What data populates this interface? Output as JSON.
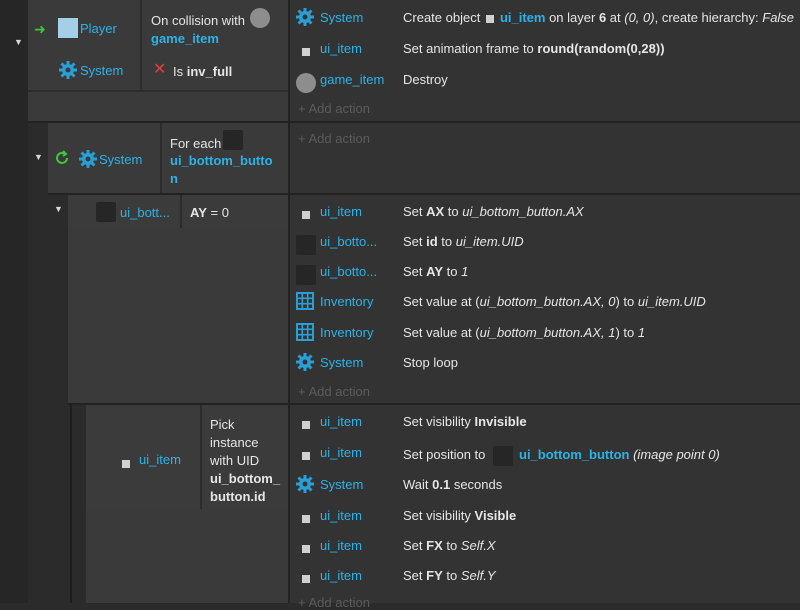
{
  "colors": {
    "object": "#2ab3e8",
    "background": "#2f2f2f",
    "green": "#3ec43e",
    "red": "#e04040"
  },
  "event1": {
    "trigger_icon": "green-arrow-icon",
    "player_label": "Player",
    "collision_label": "On collision with",
    "collision_object": "game_item",
    "system_label": "System",
    "is_label": "Is",
    "inv_full": "inv_full",
    "actions": [
      {
        "object": "System",
        "icon": "gear-icon",
        "parts": [
          "Create object ",
          "ui_item",
          " on layer ",
          "6",
          " at ",
          "(0, 0)",
          ", create hierarchy: ",
          "False"
        ]
      },
      {
        "object": "ui_item",
        "icon": "square-icon",
        "parts": [
          "Set animation frame to ",
          "round(random(0,28))"
        ]
      },
      {
        "object": "game_item",
        "icon": "circle-icon",
        "parts": [
          "Destroy"
        ]
      }
    ],
    "add_action": "+ Add action"
  },
  "event2": {
    "loop_icon": "loop-icon",
    "system_label": "System",
    "foreach_label": "For each",
    "foreach_object_line1": "ui_bottom_butto",
    "foreach_object_line2": "n",
    "add_action": "+ Add action"
  },
  "event3": {
    "object_label": "ui_bott...",
    "ay_label": "AY",
    "ay_op": "= 0",
    "actions": [
      {
        "object": "ui_item",
        "icon": "square-icon",
        "parts": [
          "Set ",
          "AX",
          " to ",
          "ui_bottom_button.AX"
        ]
      },
      {
        "object": "ui_botto...",
        "icon": "dark-square-icon",
        "parts": [
          "Set ",
          "id",
          " to ",
          "ui_item.UID"
        ]
      },
      {
        "object": "ui_botto...",
        "icon": "dark-square-icon",
        "parts": [
          "Set ",
          "AY",
          " to ",
          "1"
        ]
      },
      {
        "object": "Inventory",
        "icon": "grid-icon",
        "parts": [
          "Set value at (",
          "ui_bottom_button.AX, 0",
          ") to ",
          "ui_item.UID"
        ]
      },
      {
        "object": "Inventory",
        "icon": "grid-icon",
        "parts": [
          "Set value at (",
          "ui_bottom_button.AX, 1",
          ") to ",
          "1"
        ]
      },
      {
        "object": "System",
        "icon": "gear-icon",
        "parts": [
          "Stop loop"
        ]
      }
    ],
    "add_action": "+ Add action"
  },
  "event4": {
    "object_label": "ui_item",
    "pick_lines": [
      "Pick",
      "instance",
      "with UID"
    ],
    "pick_bold_lines": [
      "ui_bottom_",
      "button.id"
    ],
    "actions": [
      {
        "object": "ui_item",
        "icon": "square-icon",
        "parts": [
          "Set visibility ",
          "Invisible"
        ]
      },
      {
        "object": "ui_item",
        "icon": "square-icon",
        "parts": [
          "Set position to ",
          "ui_bottom_button",
          " (image point 0)"
        ]
      },
      {
        "object": "System",
        "icon": "gear-icon",
        "parts": [
          "Wait ",
          "0.1",
          " seconds"
        ]
      },
      {
        "object": "ui_item",
        "icon": "square-icon",
        "parts": [
          "Set visibility ",
          "Visible"
        ]
      },
      {
        "object": "ui_item",
        "icon": "square-icon",
        "parts": [
          "Set ",
          "FX",
          " to ",
          "Self.X"
        ]
      },
      {
        "object": "ui_item",
        "icon": "square-icon",
        "parts": [
          "Set ",
          "FY",
          " to ",
          "Self.Y"
        ]
      }
    ],
    "add_action": "+ Add action"
  }
}
